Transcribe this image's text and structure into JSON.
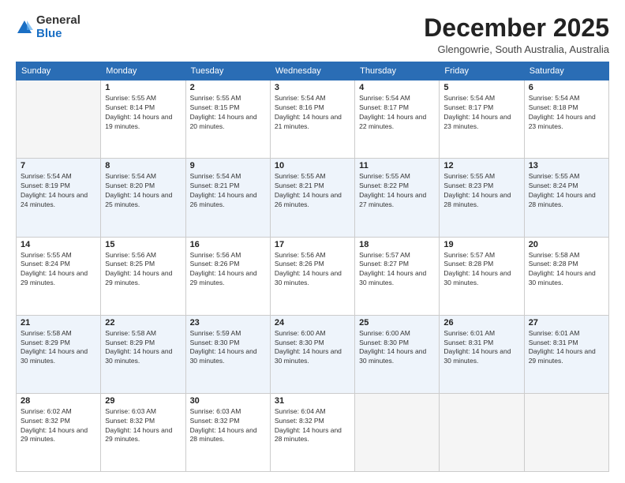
{
  "logo": {
    "general": "General",
    "blue": "Blue"
  },
  "header": {
    "month": "December 2025",
    "location": "Glengowrie, South Australia, Australia"
  },
  "weekdays": [
    "Sunday",
    "Monday",
    "Tuesday",
    "Wednesday",
    "Thursday",
    "Friday",
    "Saturday"
  ],
  "weeks": [
    [
      {
        "day": "",
        "sunrise": "",
        "sunset": "",
        "daylight": ""
      },
      {
        "day": "1",
        "sunrise": "Sunrise: 5:55 AM",
        "sunset": "Sunset: 8:14 PM",
        "daylight": "Daylight: 14 hours and 19 minutes."
      },
      {
        "day": "2",
        "sunrise": "Sunrise: 5:55 AM",
        "sunset": "Sunset: 8:15 PM",
        "daylight": "Daylight: 14 hours and 20 minutes."
      },
      {
        "day": "3",
        "sunrise": "Sunrise: 5:54 AM",
        "sunset": "Sunset: 8:16 PM",
        "daylight": "Daylight: 14 hours and 21 minutes."
      },
      {
        "day": "4",
        "sunrise": "Sunrise: 5:54 AM",
        "sunset": "Sunset: 8:17 PM",
        "daylight": "Daylight: 14 hours and 22 minutes."
      },
      {
        "day": "5",
        "sunrise": "Sunrise: 5:54 AM",
        "sunset": "Sunset: 8:17 PM",
        "daylight": "Daylight: 14 hours and 23 minutes."
      },
      {
        "day": "6",
        "sunrise": "Sunrise: 5:54 AM",
        "sunset": "Sunset: 8:18 PM",
        "daylight": "Daylight: 14 hours and 23 minutes."
      }
    ],
    [
      {
        "day": "7",
        "sunrise": "Sunrise: 5:54 AM",
        "sunset": "Sunset: 8:19 PM",
        "daylight": "Daylight: 14 hours and 24 minutes."
      },
      {
        "day": "8",
        "sunrise": "Sunrise: 5:54 AM",
        "sunset": "Sunset: 8:20 PM",
        "daylight": "Daylight: 14 hours and 25 minutes."
      },
      {
        "day": "9",
        "sunrise": "Sunrise: 5:54 AM",
        "sunset": "Sunset: 8:21 PM",
        "daylight": "Daylight: 14 hours and 26 minutes."
      },
      {
        "day": "10",
        "sunrise": "Sunrise: 5:55 AM",
        "sunset": "Sunset: 8:21 PM",
        "daylight": "Daylight: 14 hours and 26 minutes."
      },
      {
        "day": "11",
        "sunrise": "Sunrise: 5:55 AM",
        "sunset": "Sunset: 8:22 PM",
        "daylight": "Daylight: 14 hours and 27 minutes."
      },
      {
        "day": "12",
        "sunrise": "Sunrise: 5:55 AM",
        "sunset": "Sunset: 8:23 PM",
        "daylight": "Daylight: 14 hours and 28 minutes."
      },
      {
        "day": "13",
        "sunrise": "Sunrise: 5:55 AM",
        "sunset": "Sunset: 8:24 PM",
        "daylight": "Daylight: 14 hours and 28 minutes."
      }
    ],
    [
      {
        "day": "14",
        "sunrise": "Sunrise: 5:55 AM",
        "sunset": "Sunset: 8:24 PM",
        "daylight": "Daylight: 14 hours and 29 minutes."
      },
      {
        "day": "15",
        "sunrise": "Sunrise: 5:56 AM",
        "sunset": "Sunset: 8:25 PM",
        "daylight": "Daylight: 14 hours and 29 minutes."
      },
      {
        "day": "16",
        "sunrise": "Sunrise: 5:56 AM",
        "sunset": "Sunset: 8:26 PM",
        "daylight": "Daylight: 14 hours and 29 minutes."
      },
      {
        "day": "17",
        "sunrise": "Sunrise: 5:56 AM",
        "sunset": "Sunset: 8:26 PM",
        "daylight": "Daylight: 14 hours and 30 minutes."
      },
      {
        "day": "18",
        "sunrise": "Sunrise: 5:57 AM",
        "sunset": "Sunset: 8:27 PM",
        "daylight": "Daylight: 14 hours and 30 minutes."
      },
      {
        "day": "19",
        "sunrise": "Sunrise: 5:57 AM",
        "sunset": "Sunset: 8:28 PM",
        "daylight": "Daylight: 14 hours and 30 minutes."
      },
      {
        "day": "20",
        "sunrise": "Sunrise: 5:58 AM",
        "sunset": "Sunset: 8:28 PM",
        "daylight": "Daylight: 14 hours and 30 minutes."
      }
    ],
    [
      {
        "day": "21",
        "sunrise": "Sunrise: 5:58 AM",
        "sunset": "Sunset: 8:29 PM",
        "daylight": "Daylight: 14 hours and 30 minutes."
      },
      {
        "day": "22",
        "sunrise": "Sunrise: 5:58 AM",
        "sunset": "Sunset: 8:29 PM",
        "daylight": "Daylight: 14 hours and 30 minutes."
      },
      {
        "day": "23",
        "sunrise": "Sunrise: 5:59 AM",
        "sunset": "Sunset: 8:30 PM",
        "daylight": "Daylight: 14 hours and 30 minutes."
      },
      {
        "day": "24",
        "sunrise": "Sunrise: 6:00 AM",
        "sunset": "Sunset: 8:30 PM",
        "daylight": "Daylight: 14 hours and 30 minutes."
      },
      {
        "day": "25",
        "sunrise": "Sunrise: 6:00 AM",
        "sunset": "Sunset: 8:30 PM",
        "daylight": "Daylight: 14 hours and 30 minutes."
      },
      {
        "day": "26",
        "sunrise": "Sunrise: 6:01 AM",
        "sunset": "Sunset: 8:31 PM",
        "daylight": "Daylight: 14 hours and 30 minutes."
      },
      {
        "day": "27",
        "sunrise": "Sunrise: 6:01 AM",
        "sunset": "Sunset: 8:31 PM",
        "daylight": "Daylight: 14 hours and 29 minutes."
      }
    ],
    [
      {
        "day": "28",
        "sunrise": "Sunrise: 6:02 AM",
        "sunset": "Sunset: 8:32 PM",
        "daylight": "Daylight: 14 hours and 29 minutes."
      },
      {
        "day": "29",
        "sunrise": "Sunrise: 6:03 AM",
        "sunset": "Sunset: 8:32 PM",
        "daylight": "Daylight: 14 hours and 29 minutes."
      },
      {
        "day": "30",
        "sunrise": "Sunrise: 6:03 AM",
        "sunset": "Sunset: 8:32 PM",
        "daylight": "Daylight: 14 hours and 28 minutes."
      },
      {
        "day": "31",
        "sunrise": "Sunrise: 6:04 AM",
        "sunset": "Sunset: 8:32 PM",
        "daylight": "Daylight: 14 hours and 28 minutes."
      },
      {
        "day": "",
        "sunrise": "",
        "sunset": "",
        "daylight": ""
      },
      {
        "day": "",
        "sunrise": "",
        "sunset": "",
        "daylight": ""
      },
      {
        "day": "",
        "sunrise": "",
        "sunset": "",
        "daylight": ""
      }
    ]
  ]
}
